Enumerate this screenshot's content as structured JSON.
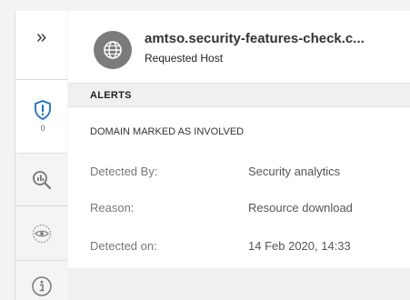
{
  "sidebar": {
    "expand_icon": "double-chevron-right-icon",
    "expand_glyph": "»",
    "alerts": {
      "icon": "shield-alert-icon",
      "count": "0"
    },
    "analyze_icon": "magnifier-analyze-icon",
    "eye_icon": "eye-scan-icon",
    "info_icon": "info-icon"
  },
  "header": {
    "icon": "globe-icon",
    "title": "amtso.security-features-check.c...",
    "subtitle": "Requested Host"
  },
  "alerts_section": {
    "title": "ALERTS",
    "alert_name": "DOMAIN MARKED AS INVOLVED",
    "rows": [
      {
        "label": "Detected By:",
        "value": "Security analytics"
      },
      {
        "label": "Reason:",
        "value": "Resource download"
      },
      {
        "label": "Detected on:",
        "value": "14 Feb 2020, 14:33"
      }
    ]
  },
  "colors": {
    "accent_blue": "#1a6fc4",
    "avatar_gray": "#7b7b7b",
    "section_bg": "#f0f0f0"
  }
}
